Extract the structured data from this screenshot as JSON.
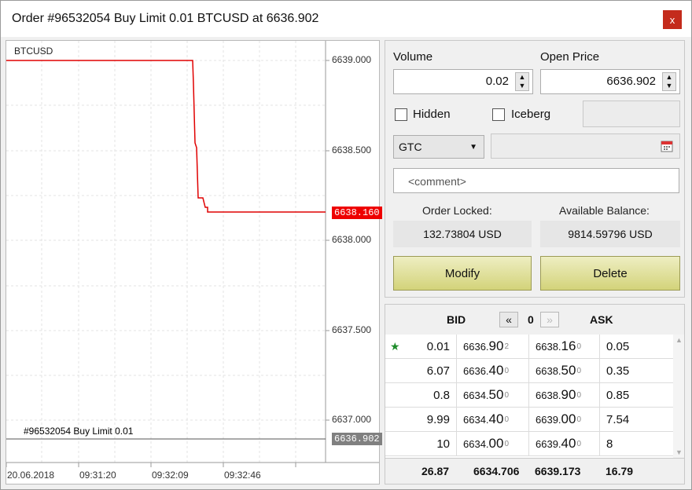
{
  "window": {
    "title": "Order #96532054 Buy Limit 0.01 BTCUSD at 6636.902",
    "close_glyph": "x"
  },
  "chart": {
    "symbol": "BTCUSD",
    "price_ticks": [
      "6639.000",
      "6638.500",
      "6638.000",
      "6637.500",
      "6637.000"
    ],
    "current_price": "6638.160",
    "order_price": "6636.902",
    "order_label": "#96532054 Buy Limit 0.01",
    "time_ticks": [
      "20.06.2018",
      "09:31:20",
      "09:32:09",
      "09:32:46"
    ],
    "line_color": "#e00000"
  },
  "form": {
    "volume_label": "Volume",
    "volume_value": "0.02",
    "open_price_label": "Open Price",
    "open_price_value": "6636.902",
    "hidden_label": "Hidden",
    "iceberg_label": "Iceberg",
    "expiration_value": "GTC",
    "comment_placeholder": "<comment>",
    "order_locked_label": "Order Locked:",
    "order_locked_value": "132.73804 USD",
    "available_balance_label": "Available Balance:",
    "available_balance_value": "9814.59796 USD",
    "modify_label": "Modify",
    "delete_label": "Delete"
  },
  "dom": {
    "bid_header": "BID",
    "ask_header": "ASK",
    "prev_glyph": "«",
    "next_glyph": "»",
    "offset": "0",
    "rows": [
      {
        "bid_vol": "0.01",
        "bid_main": "6636.",
        "bid_big": "90",
        "bid_small": "2",
        "ask_main": "6638.",
        "ask_big": "16",
        "ask_small": "0",
        "ask_vol": "0.05",
        "star": "★"
      },
      {
        "bid_vol": "6.07",
        "bid_main": "6636.",
        "bid_big": "40",
        "bid_small": "0",
        "ask_main": "6638.",
        "ask_big": "50",
        "ask_small": "0",
        "ask_vol": "0.35",
        "star": ""
      },
      {
        "bid_vol": "0.8",
        "bid_main": "6634.",
        "bid_big": "50",
        "bid_small": "0",
        "ask_main": "6638.",
        "ask_big": "90",
        "ask_small": "0",
        "ask_vol": "0.85",
        "star": ""
      },
      {
        "bid_vol": "9.99",
        "bid_main": "6634.",
        "bid_big": "40",
        "bid_small": "0",
        "ask_main": "6639.",
        "ask_big": "00",
        "ask_small": "0",
        "ask_vol": "7.54",
        "star": ""
      },
      {
        "bid_vol": "10",
        "bid_main": "6634.",
        "bid_big": "00",
        "bid_small": "0",
        "ask_main": "6639.",
        "ask_big": "40",
        "ask_small": "0",
        "ask_vol": "8",
        "star": ""
      }
    ],
    "totals": {
      "bid_vol": "26.87",
      "bid_price": "6634.706",
      "ask_price": "6639.173",
      "ask_vol": "16.79"
    }
  }
}
